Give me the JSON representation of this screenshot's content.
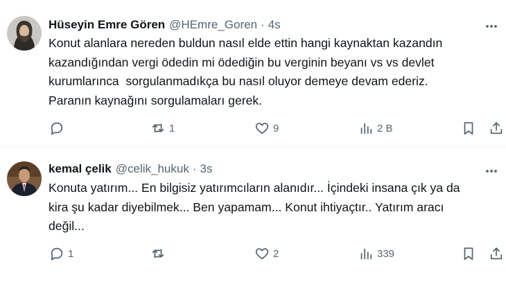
{
  "tweets": [
    {
      "author": "Hüseyin Emre Gören",
      "handle": "@HEmre_Goren",
      "separator": "·",
      "time": "4s",
      "lines": [
        "Konut alanlara nereden buldun nasıl elde ettin hangi kaynaktan kazandın",
        "kazandığından vergi ödedin mi ödediğin bu verginin beyanı vs vs devlet",
        "kurumlarınca  sorgulanmadıkça bu nasıl oluyor demeye devam ederiz.",
        "Paranın kaynağını sorgulamaları gerek."
      ],
      "replies": "",
      "reposts": "1",
      "likes": "9",
      "views": "2 B"
    },
    {
      "author": "kemal çelik",
      "handle": "@celik_hukuk",
      "separator": "·",
      "time": "3s",
      "lines": [
        "Konuta yatırım... En bilgisiz yatırımcıların alanıdır... İçindeki insana çık ya da",
        "kira şu kadar diyebilmek... Ben yapamam... Konut ihtiyaçtır.. Yatırım aracı",
        "değil..."
      ],
      "replies": "1",
      "reposts": "",
      "likes": "2",
      "views": "339"
    }
  ],
  "colors": {
    "text": "#0f1419",
    "secondary": "#536471",
    "divider": "#eff3f4",
    "background": "#ffffff"
  },
  "icons": [
    "more-icon",
    "reply-icon",
    "repost-icon",
    "like-icon",
    "views-icon",
    "bookmark-icon",
    "share-icon"
  ]
}
